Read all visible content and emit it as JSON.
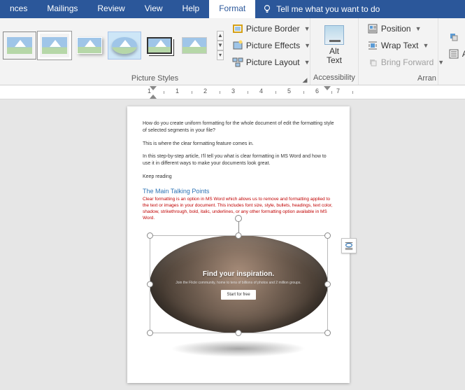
{
  "tabs": {
    "references_partial": "nces",
    "mailings": "Mailings",
    "review": "Review",
    "view": "View",
    "help": "Help",
    "format": "Format",
    "tell_me": "Tell me what you want to do"
  },
  "ribbon": {
    "picture_styles": {
      "title": "Picture Styles"
    },
    "picture_opts": {
      "border": "Picture Border",
      "effects": "Picture Effects",
      "layout": "Picture Layout"
    },
    "alt_text": {
      "label1": "Alt",
      "label2": "Text"
    },
    "accessibility_title": "Accessibility",
    "arrange": {
      "position": "Position",
      "wrap": "Wrap Text",
      "bring_forward": "Bring Forward",
      "title": "Arran"
    },
    "right_partial": {
      "a": "A"
    }
  },
  "ruler_numbers": [
    "1",
    "1",
    "2",
    "3",
    "4",
    "5",
    "6",
    "7"
  ],
  "doc": {
    "p1": "How do you create uniform formatting for the whole document of edit the formatting style of selected segments in your file?",
    "p2": "This is where the clear formatting feature comes in.",
    "p3": "In this step-by-step article, I'll tell you what is clear formatting in MS Word and how to use it in different ways to make your documents look great.",
    "p4": "Keep reading",
    "heading": "The Main Talking Points",
    "red": "Clear formatting is an option in MS Word which allows us to remove and formatting applied to the text or images in your document. This includes font size, style, bullets, headings, text color, shadow, strikethrough, bold, italic, underlines, or any other formatting option available in MS Word."
  },
  "image_content": {
    "title": "Find your inspiration.",
    "subtitle": "Join the Flickr community, home to tens of billions of photos and 2 million groups.",
    "button": "Start for free"
  }
}
